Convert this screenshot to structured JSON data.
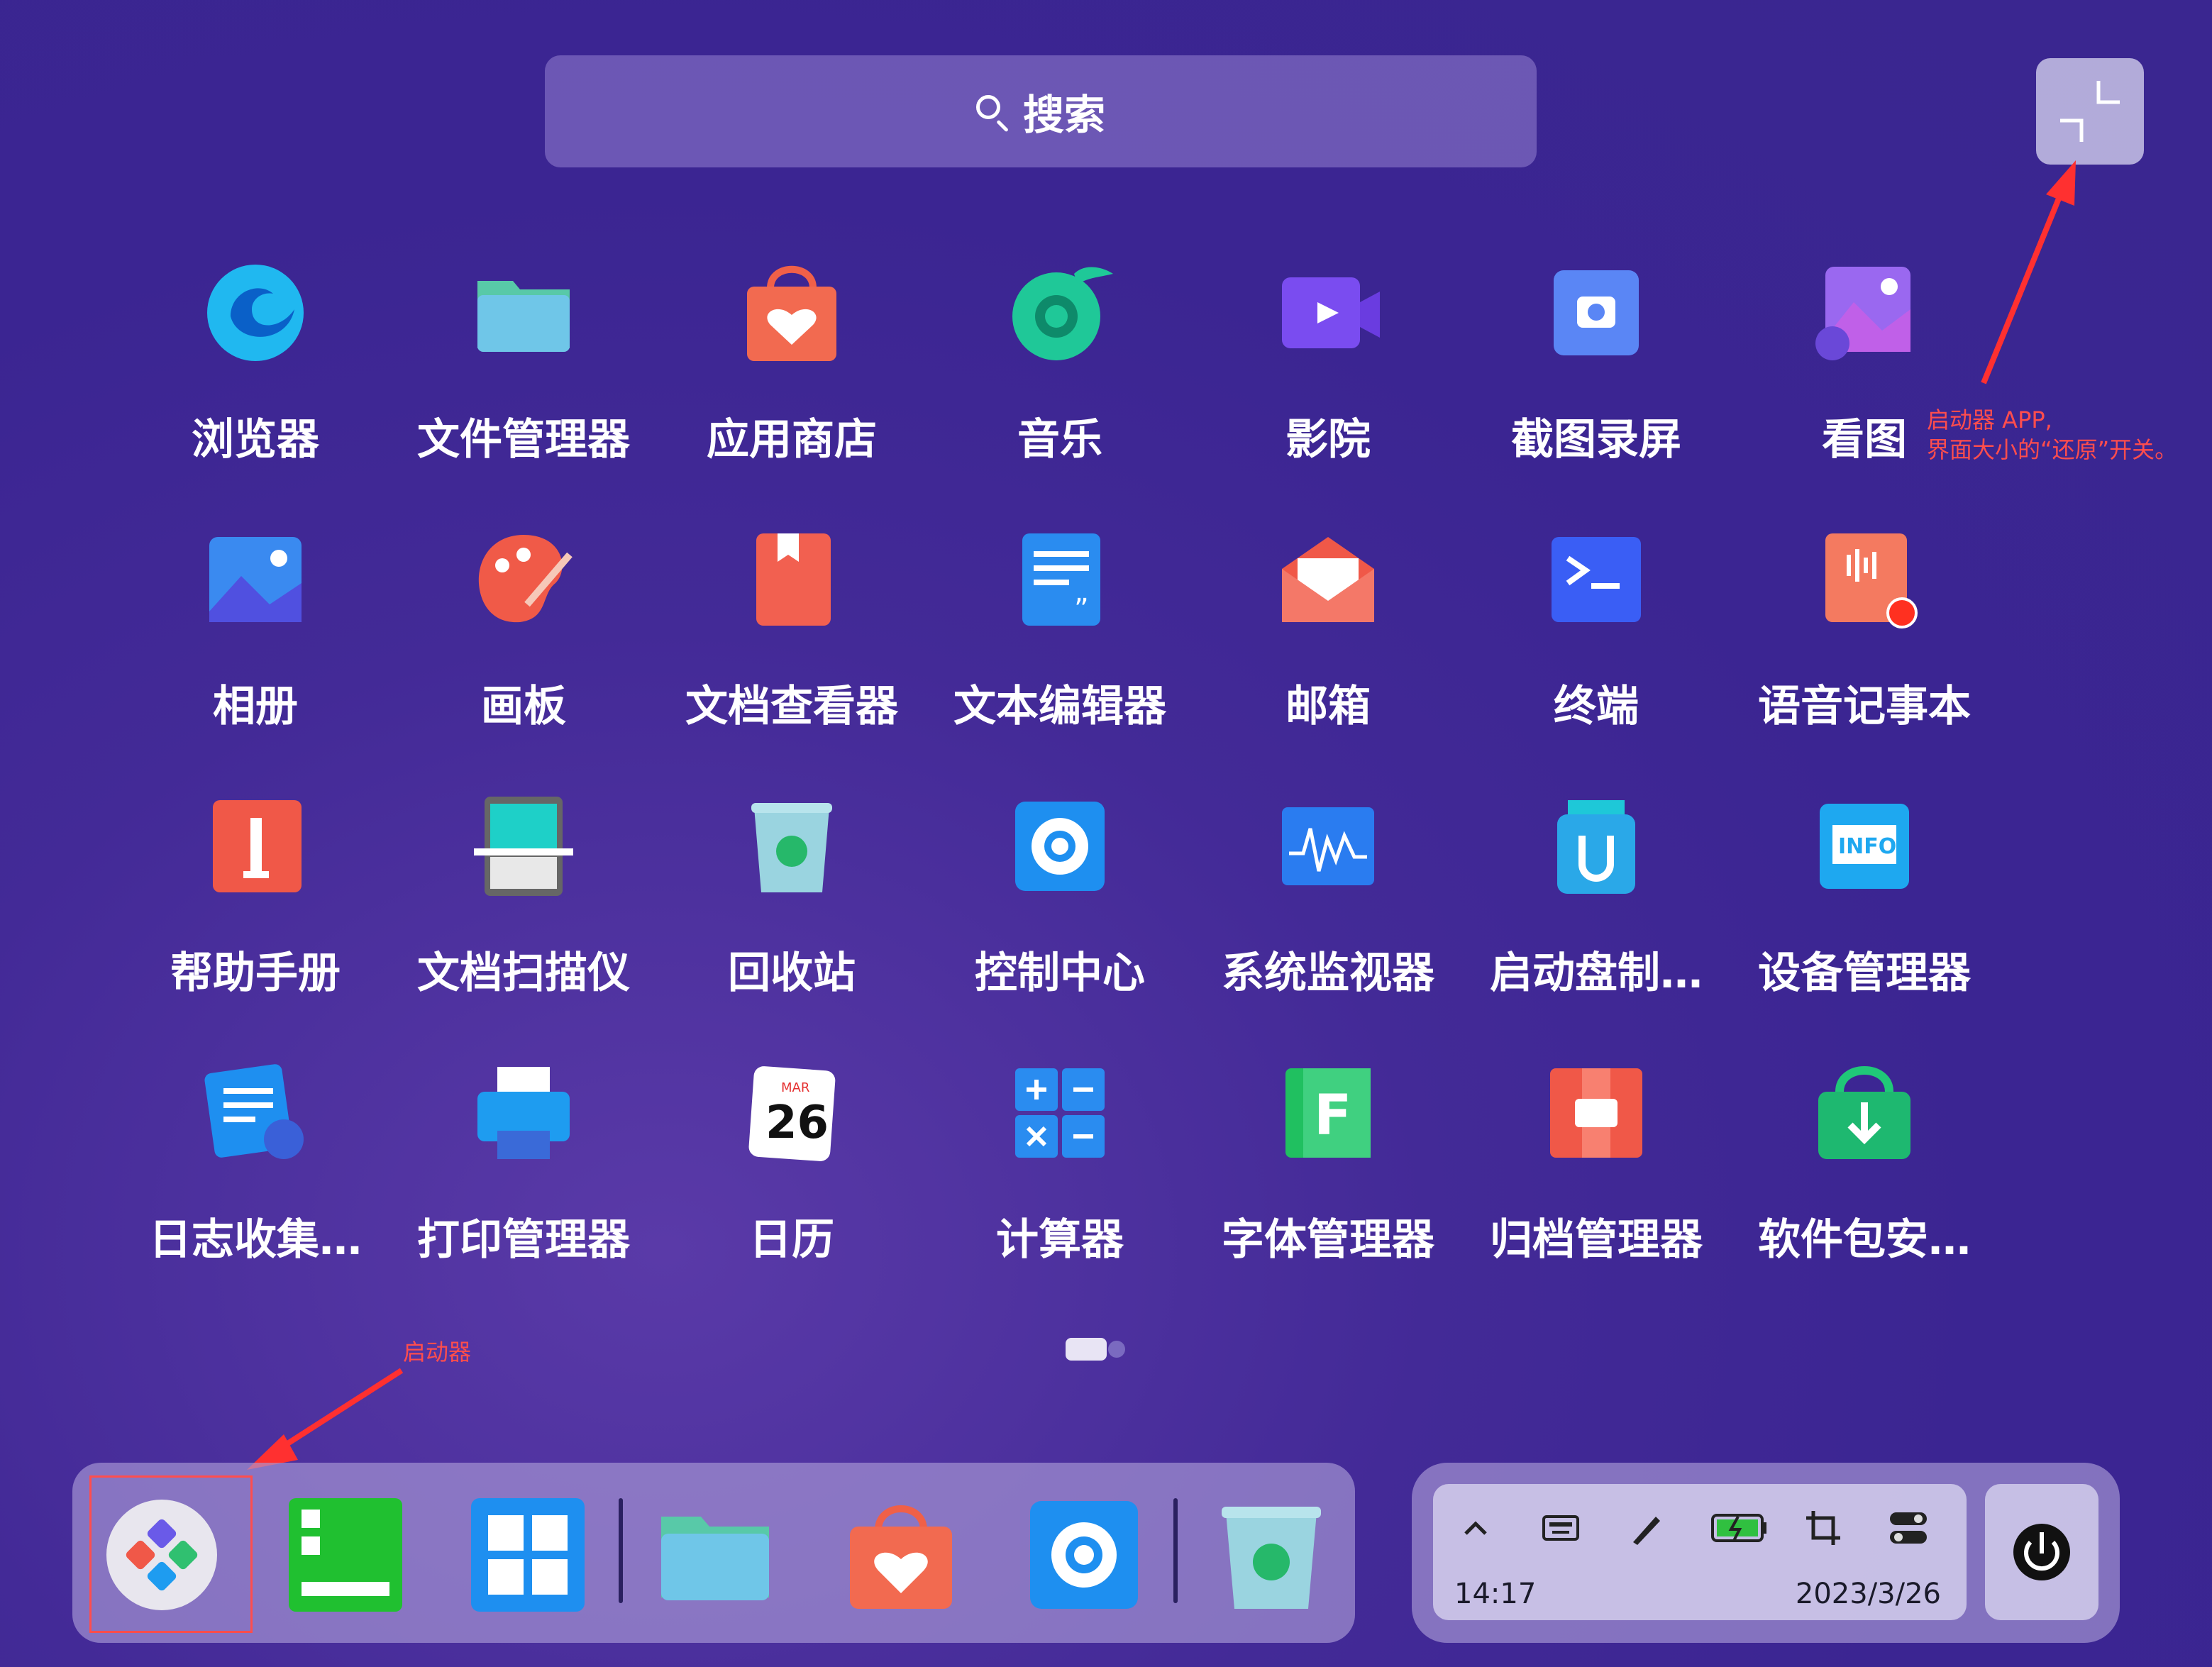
{
  "search": {
    "label": "搜索"
  },
  "annotations": {
    "restore": [
      "启动器 APP,",
      "界面大小的“还原”开关。"
    ],
    "launcher": "启动器"
  },
  "apps": [
    {
      "label": "浏览器",
      "icon": "browser-icon"
    },
    {
      "label": "文件管理器",
      "icon": "file-manager-icon"
    },
    {
      "label": "应用商店",
      "icon": "app-store-icon"
    },
    {
      "label": "音乐",
      "icon": "music-icon"
    },
    {
      "label": "影院",
      "icon": "movie-icon"
    },
    {
      "label": "截图录屏",
      "icon": "screenshot-icon"
    },
    {
      "label": "看图",
      "icon": "image-viewer-icon"
    },
    {
      "label": "相册",
      "icon": "album-icon"
    },
    {
      "label": "画板",
      "icon": "draw-icon"
    },
    {
      "label": "文档查看器",
      "icon": "document-viewer-icon"
    },
    {
      "label": "文本编辑器",
      "icon": "text-editor-icon"
    },
    {
      "label": "邮箱",
      "icon": "mail-icon"
    },
    {
      "label": "终端",
      "icon": "terminal-icon"
    },
    {
      "label": "语音记事本",
      "icon": "voice-note-icon"
    },
    {
      "label": "帮助手册",
      "icon": "help-manual-icon"
    },
    {
      "label": "文档扫描仪",
      "icon": "scanner-icon"
    },
    {
      "label": "回收站",
      "icon": "trash-icon"
    },
    {
      "label": "控制中心",
      "icon": "control-center-icon"
    },
    {
      "label": "系统监视器",
      "icon": "system-monitor-icon"
    },
    {
      "label": "启动盘制…",
      "icon": "boot-maker-icon"
    },
    {
      "label": "设备管理器",
      "icon": "device-manager-icon"
    },
    {
      "label": "日志收集…",
      "icon": "log-collector-icon"
    },
    {
      "label": "打印管理器",
      "icon": "print-manager-icon"
    },
    {
      "label": "日历",
      "icon": "calendar-icon"
    },
    {
      "label": "计算器",
      "icon": "calculator-icon"
    },
    {
      "label": "字体管理器",
      "icon": "font-manager-icon"
    },
    {
      "label": "归档管理器",
      "icon": "archive-manager-icon"
    },
    {
      "label": "软件包安…",
      "icon": "package-installer-icon"
    }
  ],
  "calendar": {
    "month": "MAR",
    "day": "26"
  },
  "tray": {
    "time": "14:17",
    "date": "2023/3/26"
  },
  "colors": {
    "accent": "#ff4d4d",
    "background": "#3b2592"
  }
}
